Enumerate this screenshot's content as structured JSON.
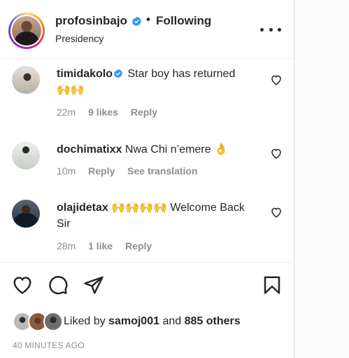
{
  "header": {
    "username": "profosinbajo",
    "separator": "•",
    "follow_status": "Following",
    "location": "Presidency"
  },
  "comments": [
    {
      "username": "timidakolo",
      "verified": true,
      "text": "Star boy has returned",
      "emoji": "🙌🙌",
      "time": "22m",
      "likes": "9 likes",
      "reply": "Reply"
    },
    {
      "username": "dochimatixx",
      "verified": false,
      "text": "Nwa Chi n’emere 👌",
      "time": "10m",
      "reply": "Reply",
      "translate": "See translation"
    },
    {
      "username": "olajidetax",
      "verified": false,
      "emoji": "🙌🙌🙌🙌",
      "text": "Welcome Back Sir",
      "time": "28m",
      "likes": "1 like",
      "reply": "Reply"
    }
  ],
  "likes": {
    "prefix": "Liked by",
    "user": "samoj001",
    "and": "and",
    "others": "885 others"
  },
  "timestamp": "40 MINUTES AGO",
  "colors": {
    "text": "#262626",
    "muted": "#8e8e8e",
    "verified": "#3897f0",
    "divider": "#efefef"
  }
}
